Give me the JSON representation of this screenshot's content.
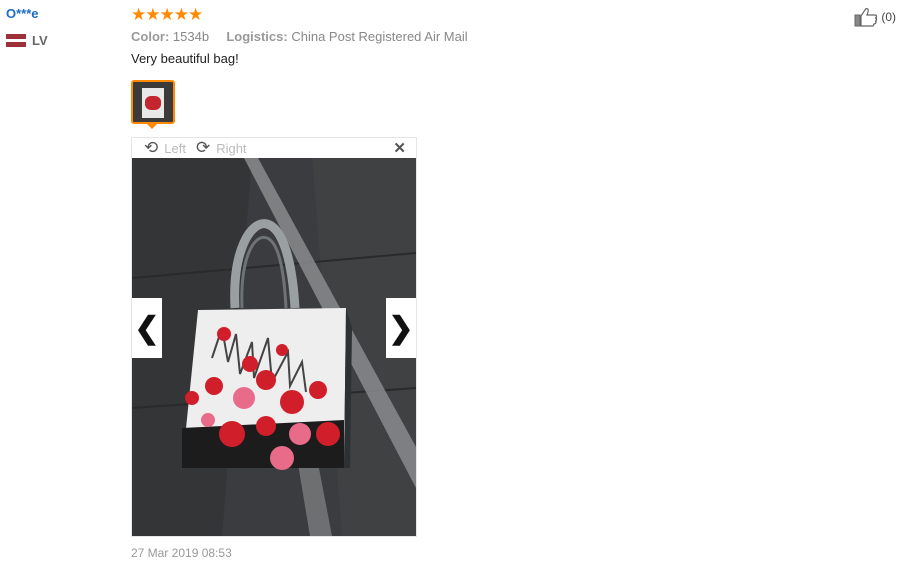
{
  "user": {
    "name": "O***e",
    "country_code": "LV",
    "flag_colors": [
      "#9e3039",
      "#ffffff"
    ]
  },
  "review": {
    "rating": 5,
    "rating_max": 5,
    "stars": "★★★★★",
    "star_color": "#ff8a00",
    "color_label": "Color:",
    "color_value": "1534b",
    "logistics_label": "Logistics:",
    "logistics_value": "China Post Registered Air Mail",
    "text": "Very beautiful bag!",
    "date": "27 Mar 2019 08:53"
  },
  "viewer": {
    "rotate_left_label": "Left",
    "rotate_right_label": "Right",
    "close_glyph": "✕",
    "prev_glyph": "❮",
    "next_glyph": "❯"
  },
  "helpful": {
    "count_text": "(0)"
  },
  "colors": {
    "username": "#1a6dc4",
    "accent": "#ff8a00"
  }
}
